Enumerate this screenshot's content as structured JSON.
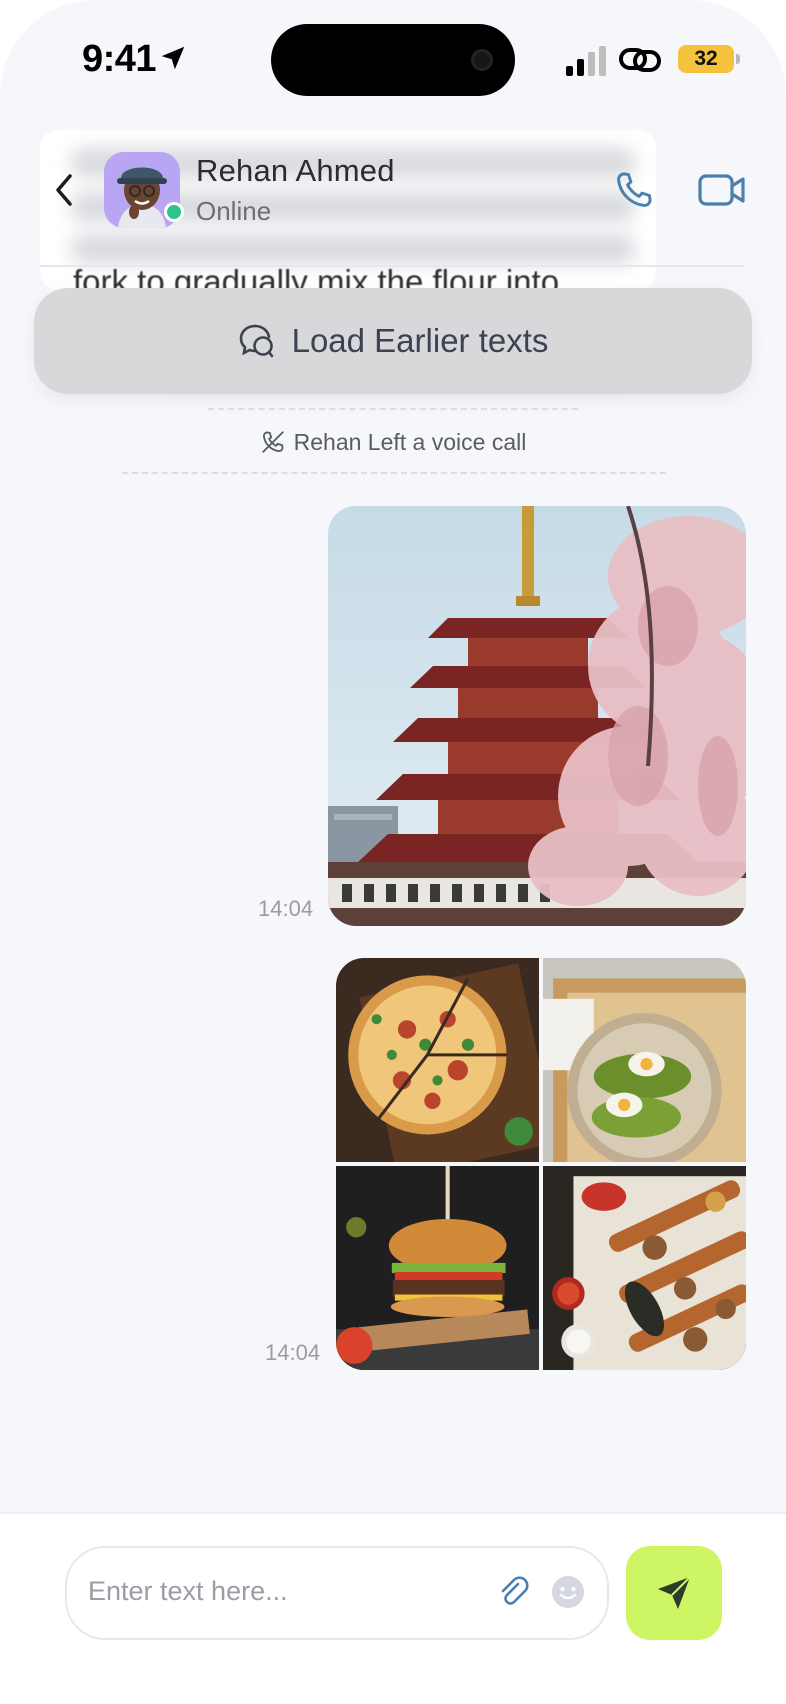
{
  "status_bar": {
    "time": "9:41",
    "battery": "32"
  },
  "header": {
    "contact_name": "Rehan Ahmed",
    "contact_status": "Online",
    "blurred_preview_text": "fork to gradually mix the flour into"
  },
  "load_earlier": {
    "label": "Load Earlier texts"
  },
  "call_notice": {
    "text": "Rehan Left a voice call"
  },
  "messages": [
    {
      "type": "image",
      "subject": "pagoda with cherry blossoms",
      "time": "14:04"
    },
    {
      "type": "image-grid",
      "subjects": [
        "pizza",
        "avocado toast with egg",
        "burger",
        "grilled kebab platter"
      ],
      "time": "14:04"
    }
  ],
  "composer": {
    "placeholder": "Enter text here..."
  },
  "colors": {
    "accent": "#cdf564",
    "online": "#2fc38d",
    "icon_blue": "#4a7fb0",
    "background": "#f6f7fa"
  },
  "icons": [
    "location-arrow-icon",
    "signal-icon",
    "link-icon",
    "back-arrow-icon",
    "phone-icon",
    "video-icon",
    "chat-bubbles-icon",
    "missed-call-icon",
    "paperclip-icon",
    "emoji-icon",
    "send-icon"
  ]
}
